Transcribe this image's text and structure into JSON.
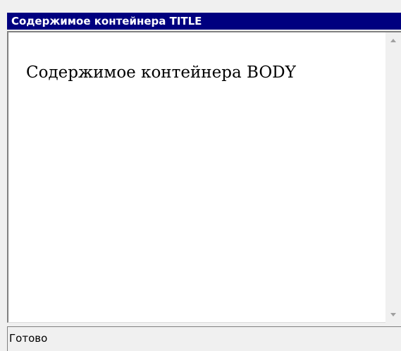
{
  "window": {
    "title": "Содержимое контейнера TITLE"
  },
  "content": {
    "body_text": "Содержимое контейнера BODY"
  },
  "status": {
    "text": "Готово"
  },
  "icons": {
    "scroll_up": "scroll-up-arrow-icon",
    "scroll_down": "scroll-down-arrow-icon"
  },
  "colors": {
    "title_bar": "#00007f",
    "title_text": "#ffffff",
    "client_bg": "#ffffff",
    "chrome_bg": "#f0f0f0"
  }
}
